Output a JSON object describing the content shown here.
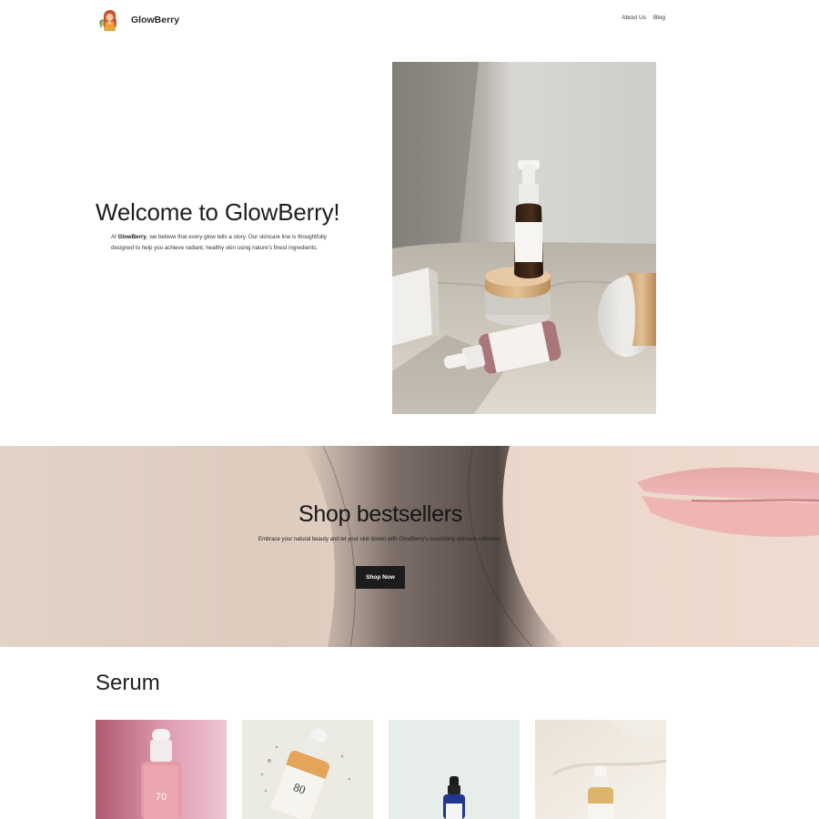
{
  "header": {
    "brand": "GlowBerry",
    "nav": [
      {
        "label": "About Us"
      },
      {
        "label": "Blog"
      }
    ]
  },
  "hero": {
    "title": "Welcome to GlowBerry!",
    "intro_prefix": "At ",
    "intro_brand": "GlowBerry",
    "intro_rest": ", we believe that every glow tells a story. Our skincare line is thoughtfully designed to help you achieve radiant, healthy skin using nature's finest ingredients."
  },
  "banner": {
    "title": "Shop bestsellers",
    "text": "Embrace your natural beauty and let your skin bloom with GlowBerry's nourishing skincare collection.",
    "button_label": "Shop Now"
  },
  "serum": {
    "title": "Serum",
    "product_label_1": "70",
    "product_label_2": "80"
  },
  "colors": {
    "button_bg": "#1c1c1c",
    "text_primary": "#1f1f1f",
    "banner_bg": "#e4d6cb"
  }
}
